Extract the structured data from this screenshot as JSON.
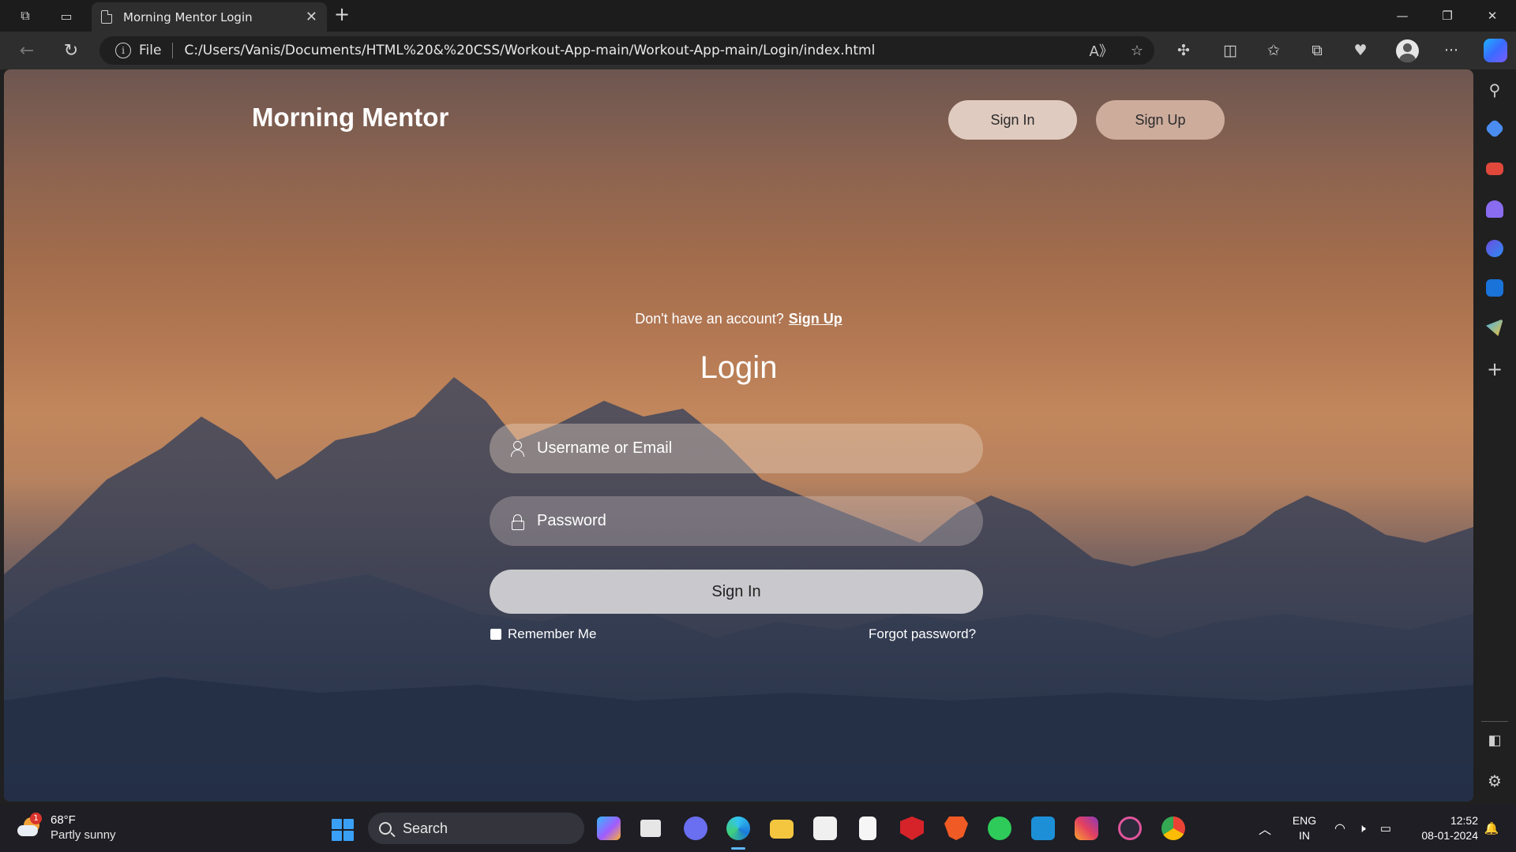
{
  "browser": {
    "tab_title": "Morning Mentor Login",
    "address_scheme_label": "File",
    "url": "C:/Users/Vanis/Documents/HTML%20&%20CSS/Workout-App-main/Workout-App-main/Login/index.html"
  },
  "page": {
    "brand": "Morning Mentor",
    "header_buttons": {
      "sign_in": "Sign In",
      "sign_up": "Sign Up"
    },
    "prompt_text": "Don't have an account?",
    "prompt_link": "Sign Up",
    "title": "Login",
    "username_placeholder": "Username or Email",
    "password_placeholder": "Password",
    "submit_label": "Sign In",
    "remember_label": "Remember Me",
    "forgot_label": "Forgot password?"
  },
  "taskbar": {
    "weather_temp": "68°F",
    "weather_condition": "Partly sunny",
    "weather_badge": "1",
    "search_label": "Search",
    "language": "ENG",
    "region": "IN",
    "time": "12:52",
    "date": "08-01-2024"
  },
  "colors": {
    "header_sign_in_bg": "#e0cbc0",
    "header_sign_up_bg": "#cdac9c",
    "submit_bg": "#c9c8cc",
    "accent": "#3aa0f5"
  }
}
